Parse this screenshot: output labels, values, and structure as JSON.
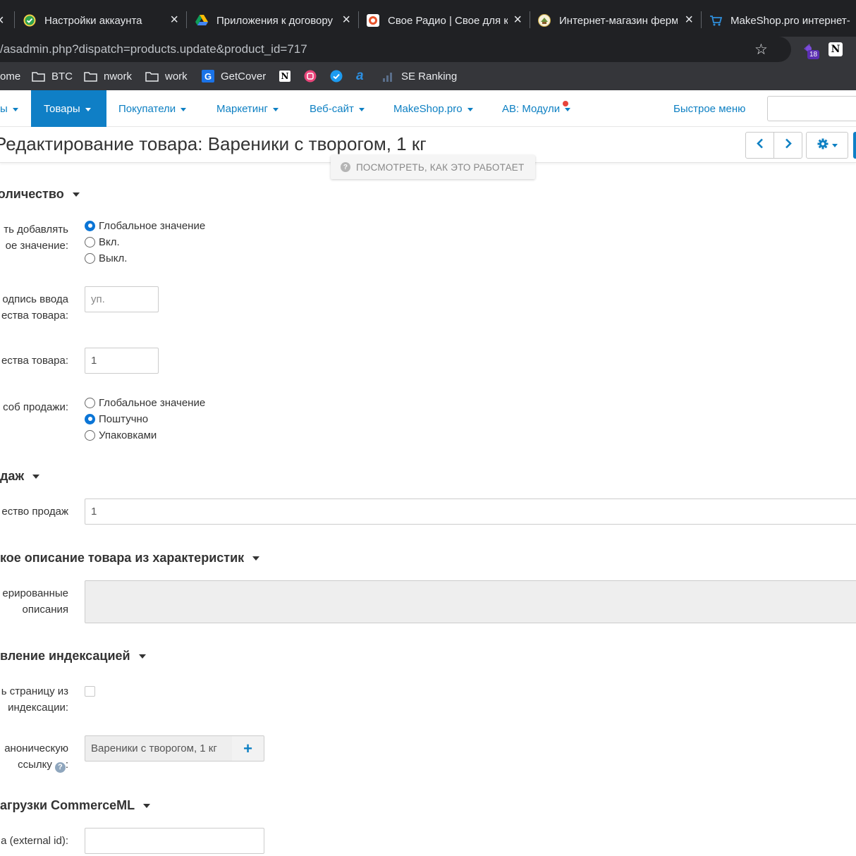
{
  "browser": {
    "tabs": [
      {
        "title": "Настройки аккаунта",
        "icon": "shield-check-icon"
      },
      {
        "title": "Приложения к договору",
        "icon": "google-drive-icon"
      },
      {
        "title": "Свое Радио | Свое для к",
        "icon": "radio-icon"
      },
      {
        "title": "Интернет-магазин ферм",
        "icon": "farm-shop-icon"
      },
      {
        "title": "MakeShop.pro интернет-",
        "icon": "cart-icon"
      }
    ],
    "url": "/asadmin.php?dispatch=products.update&product_id=717",
    "extension_badge": "18",
    "bookmarks": [
      "ome",
      "BTC",
      "nwork",
      "work",
      "GetCover",
      "SE Ranking"
    ]
  },
  "nav": {
    "items": [
      "ы",
      "Товары",
      "Покупатели",
      "Маркетинг",
      "Веб-сайт",
      "MakeShop.pro",
      "AB: Модули"
    ],
    "quick_menu": "Быстрое меню"
  },
  "header": {
    "title": "Редактирование товара: Вареники с творогом, 1 кг",
    "help": "ПОСМОТРЕТЬ, КАК ЭТО РАБОТАЕТ"
  },
  "form": {
    "section_quantity": "количество",
    "label_allow_add_1": "ть добавлять",
    "label_allow_add_2": "ое значение:",
    "allow_add_options": [
      "Глобальное значение",
      "Вкл.",
      "Выкл."
    ],
    "label_caption_1": "одпись ввода",
    "label_caption_2": "ества товара:",
    "caption_placeholder": "уп.",
    "label_qty": "ества товара:",
    "qty_value": "1",
    "label_sale_method": "соб продажи:",
    "sale_method_options": [
      "Глобальное значение",
      "Поштучно",
      "Упаковками"
    ],
    "section_sales": "даж",
    "label_sales_count": "ество продаж",
    "sales_count_value": "1",
    "section_description": "кое описание товара из характеристик",
    "label_generated_1": "ерированные",
    "label_generated_2": "описания",
    "section_indexing": "вление индексацией",
    "label_exclude_1": "ь страницу из",
    "label_exclude_2": "индексации:",
    "label_canonical_1": "анoническую",
    "label_canonical_2": "ссылку",
    "canonical_value": "Вареники с творогом, 1 кг",
    "section_commerceml": "агрузки CommerceML",
    "label_external_id": "a (external id):",
    "external_id_value": ""
  }
}
